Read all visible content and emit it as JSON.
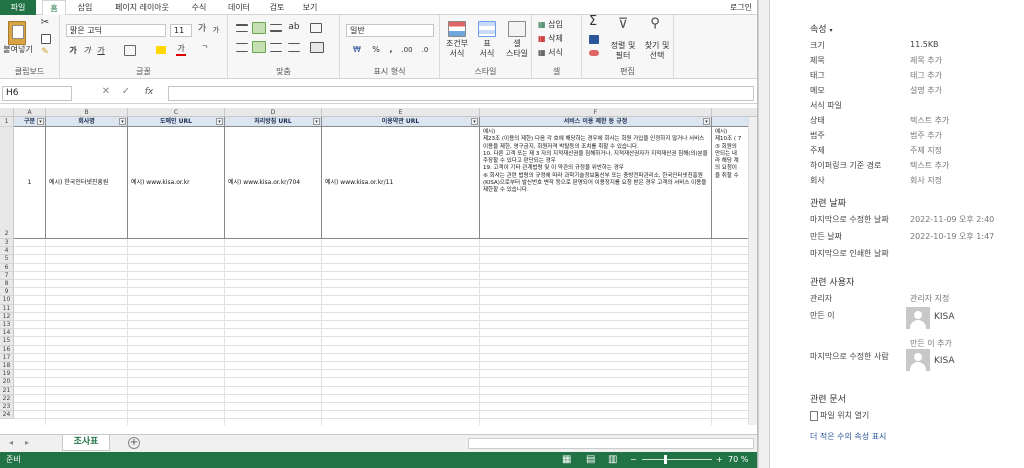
{
  "ribbon": {
    "tabs": [
      "파일",
      "홈",
      "삽입",
      "페이지 레이아웃",
      "수식",
      "데이터",
      "검토",
      "보기"
    ],
    "login": "로그인",
    "groups": {
      "clipboard": "클립보드",
      "font": "글꼴",
      "align": "맞춤",
      "number": "표시 형식",
      "style": "스타일",
      "cells": "셀",
      "edit": "편집"
    },
    "paste": "붙여넣기",
    "font_name": "맑은 고딕",
    "font_size": "11",
    "number_format": "일반",
    "cond_format": "조건부\n서식",
    "table_format": "표\n서식",
    "cell_style": "셀\n스타일",
    "insert": "삽입",
    "delete": "삭제",
    "format": "서식",
    "sort_filter": "정렬 및\n필터",
    "find_select": "찾기 및\n선택"
  },
  "formula": {
    "cell": "H6",
    "fx": "fx"
  },
  "sheet": {
    "columns": [
      "A",
      "B",
      "C",
      "D",
      "E",
      "F"
    ],
    "headers": [
      "구분",
      "회사명",
      "도메인 URL",
      "처리방침 URL",
      "이용약관 URL",
      "서비스 이용 제한 등 규정"
    ],
    "row": {
      "num": "1",
      "company": "예시) 한국인터넷진흥원",
      "domain": "예시) www.kisa.or.kr",
      "policy": "예시) www.kisa.or.kr/704",
      "terms": "예시) www.kisa.or.kr/11",
      "rules": "예시)\n제23조 (이용의 제한) 다음 각 호에 해당하는 경우에 회사는 회원 가입을 인정하지 않거나 서비스 이용을 제한, 영구금지, 회원자격 박탈등의 조치를 취할 수 있습니다.\n10. 다른 고객 또는 제 3 자의 지적재산권을 침해하거나, 지적재산권자가 지적재산권 침해(의)분을 주장할 수 있다고 판단되는 경우\n19. 고객이 기타 관계법령 및 이 약관의 규정을 위반하는 경우\n⑥ 회사는 관련 법령의 규정에 따라 과학기술정보통신부 또는 충방전파관리소, 한국인터넷진흥원(KISA)으로부터 발신번호 변작 등으로 판명되어 이용정지를 요청 받은 경우 고객의 서비스 이용을 제한할 수 있습니다.",
      "g": "예시)\n제10조 ( 7\n⑤ 회원의\n만되는 내\n라 해당 계\n의 요청이\n을 취할 수"
    },
    "row_numbers": [
      "1",
      "2",
      "3",
      "4",
      "5",
      "6",
      "7",
      "8",
      "9",
      "10",
      "11",
      "12",
      "13",
      "14",
      "15",
      "16",
      "17",
      "18",
      "19",
      "20",
      "21",
      "22",
      "23",
      "24"
    ],
    "tab": "조사표",
    "status_left": "준비",
    "zoom": "70 %"
  },
  "properties": {
    "title": "속성",
    "items": [
      {
        "label": "크기",
        "value": "11.5KB"
      },
      {
        "label": "제목",
        "value": "제목 추가"
      },
      {
        "label": "태그",
        "value": "태그 추가"
      },
      {
        "label": "메모",
        "value": "설명 추가"
      },
      {
        "label": "서식 파일",
        "value": ""
      },
      {
        "label": "상태",
        "value": "텍스트 추가"
      },
      {
        "label": "범주",
        "value": "범주 추가"
      },
      {
        "label": "주제",
        "value": "주제 지정"
      },
      {
        "label": "하이퍼링크 기준 경로",
        "value": "텍스트 추가"
      },
      {
        "label": "회사",
        "value": "회사 지정"
      }
    ],
    "dates_title": "관련 날짜",
    "dates": [
      {
        "label": "마지막으로 수정한 날짜",
        "value": "2022-11-09 오후 2:40"
      },
      {
        "label": "만든 날짜",
        "value": "2022-10-19 오후 1:47"
      },
      {
        "label": "마지막으로 인쇄한 날짜",
        "value": ""
      }
    ],
    "people_title": "관련 사용자",
    "manager_label": "관리자",
    "manager_value": "관리자 지정",
    "creator_label": "만든 이",
    "creator_name": "KISA",
    "creator_add": "만든 이 추가",
    "modifier_label": "마지막으로 수정한 사람",
    "modifier_name": "KISA",
    "docs_title": "관련 문서",
    "open_location": "파일 위치 열기",
    "fewer_link": "더 적은 수의 속성 표시"
  }
}
